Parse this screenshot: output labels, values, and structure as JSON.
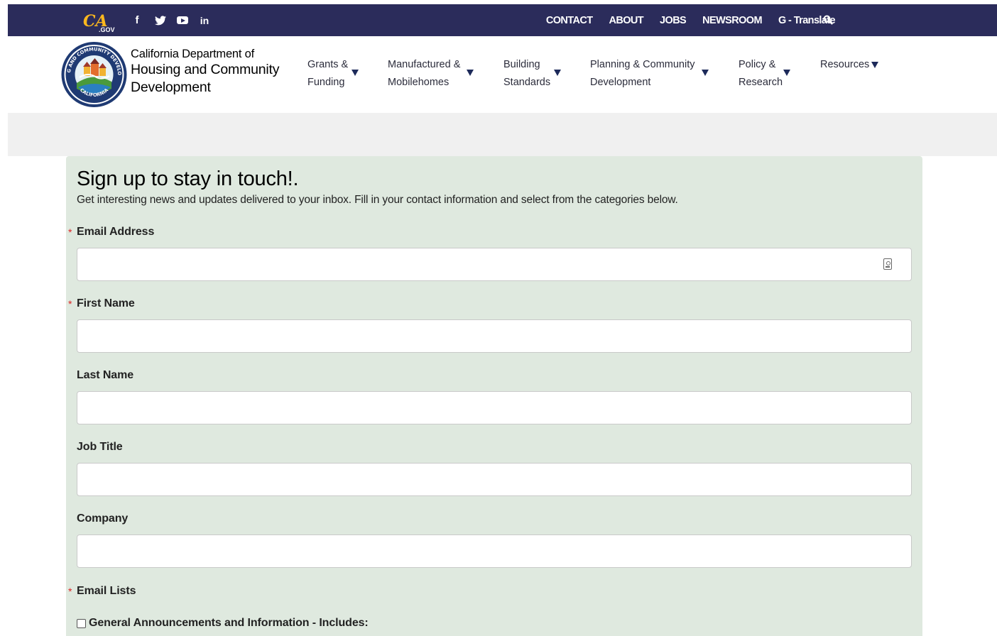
{
  "utility_bar": {
    "ca_logo_text": "CA",
    "ca_logo_sub": ".GOV",
    "social": [
      {
        "icon": "facebook-icon",
        "glyph": "f"
      },
      {
        "icon": "twitter-icon",
        "glyph": "🐦"
      },
      {
        "icon": "youtube-icon",
        "glyph": ""
      },
      {
        "icon": "linkedin-icon",
        "glyph": "in"
      }
    ],
    "links": [
      "CONTACT",
      "ABOUT",
      "JOBS",
      "NEWSROOM",
      "G - Translate"
    ],
    "search_icon": "search-icon"
  },
  "header": {
    "dept_line1": "California Department of",
    "dept_line2": "Housing and Community",
    "dept_line3": "Development",
    "seal_text_top": "HOUSING AND COMMUNITY DEVELOPMENT",
    "seal_text_bottom": "CALIFORNIA",
    "nav": [
      {
        "line1": "Grants &",
        "line2": "Funding"
      },
      {
        "line1": "Manufactured &",
        "line2": "Mobilehomes"
      },
      {
        "line1": "Building",
        "line2": "Standards"
      },
      {
        "line1": "Planning & Community",
        "line2": "Development"
      },
      {
        "line1": "Policy &",
        "line2": "Research"
      },
      {
        "line1": "Resources",
        "line2": ""
      }
    ]
  },
  "form": {
    "title": "Sign up to stay in touch!.",
    "subtitle": "Get interesting news and updates delivered to your inbox. Fill in your contact information and select from the categories below.",
    "required_marker": "*",
    "fields": [
      {
        "label": "Email Address",
        "value": "",
        "required": true
      },
      {
        "label": "First Name",
        "value": "",
        "required": true
      },
      {
        "label": "Last Name",
        "value": "",
        "required": false
      },
      {
        "label": "Job Title",
        "value": "",
        "required": false
      },
      {
        "label": "Company",
        "value": "",
        "required": false
      }
    ],
    "email_lists_label": "Email Lists",
    "email_lists": [
      {
        "label": "General Announcements and Information - Includes:",
        "checked": false
      }
    ]
  },
  "colors": {
    "topbar": "#2b2c5b",
    "form_bg": "#dfe9df",
    "gray_band": "#f0f0f0",
    "required": "#dd2222",
    "ca_gold": "#fdb81e"
  }
}
